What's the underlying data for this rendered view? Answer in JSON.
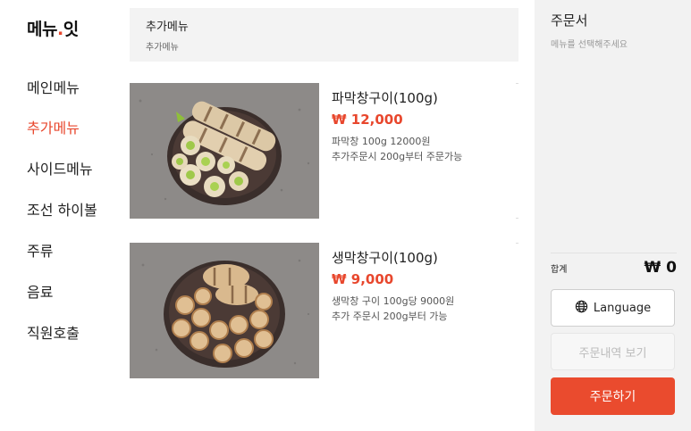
{
  "brand": {
    "logo_main": "메뉴",
    "logo_dot": ".",
    "logo_tail": "잇"
  },
  "sidebar": {
    "items": [
      {
        "label": "메인메뉴",
        "active": false
      },
      {
        "label": "추가메뉴",
        "active": true
      },
      {
        "label": "사이드메뉴",
        "active": false
      },
      {
        "label": "조선 하이볼",
        "active": false
      },
      {
        "label": "주류",
        "active": false
      },
      {
        "label": "음료",
        "active": false
      },
      {
        "label": "직원호출",
        "active": false
      }
    ]
  },
  "category": {
    "title": "추가메뉴",
    "subtitle": "추가메뉴"
  },
  "menu": [
    {
      "name": "파막창구이(100g)",
      "price": "₩ 12,000",
      "desc1": "파막창 100g 12000원",
      "desc2": "추가주문시 200g부터 주문가능"
    },
    {
      "name": "생막창구이(100g)",
      "price": "₩ 9,000",
      "desc1": "생막창 구이 100g당 9000원",
      "desc2": "추가 주문시 200g부터 가능"
    }
  ],
  "order": {
    "title": "주문서",
    "placeholder": "메뉴를 선택해주세요",
    "total_label": "합계",
    "total_value": "₩ 0",
    "language_label": "Language",
    "history_label": "주문내역 보기",
    "order_label": "주문하기"
  },
  "colors": {
    "accent": "#ea4b2e",
    "panel": "#f2f2f2"
  }
}
